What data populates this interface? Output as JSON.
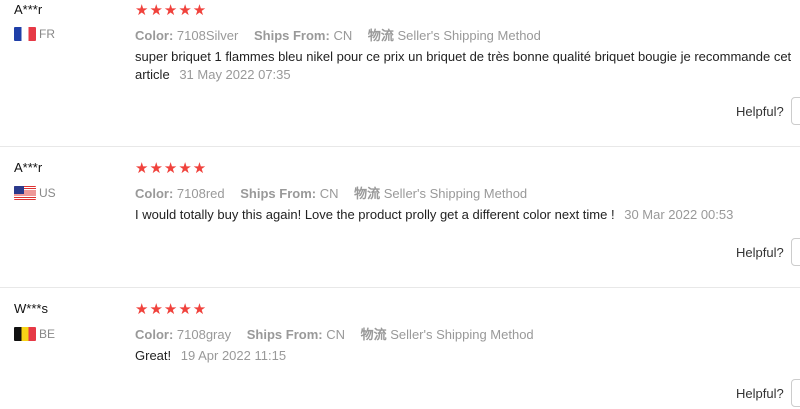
{
  "labels": {
    "color": "Color:",
    "ships_from": "Ships From:",
    "shipping_method_key": "物流",
    "helpful": "Helpful?"
  },
  "reviews": [
    {
      "user": "A***r",
      "country": "FR",
      "stars": "★★★★★",
      "rating": 5,
      "color": "7108Silver",
      "ships_from": "CN",
      "shipping_method": "Seller's Shipping Method",
      "text": "super briquet 1 flammes bleu nikel pour ce prix un briquet de très bonne qualité briquet bougie je recommande cet article",
      "date": "31 May 2022 07:35"
    },
    {
      "user": "A***r",
      "country": "US",
      "stars": "★★★★★",
      "rating": 5,
      "color": "7108red",
      "ships_from": "CN",
      "shipping_method": "Seller's Shipping Method",
      "text": "I would totally buy this again! Love the product prolly get a different color next time !",
      "date": "30 Mar 2022 00:53"
    },
    {
      "user": "W***s",
      "country": "BE",
      "stars": "★★★★★",
      "rating": 5,
      "color": "7108gray",
      "ships_from": "CN",
      "shipping_method": "Seller's Shipping Method",
      "text": "Great!",
      "date": "19 Apr 2022 11:15"
    }
  ]
}
